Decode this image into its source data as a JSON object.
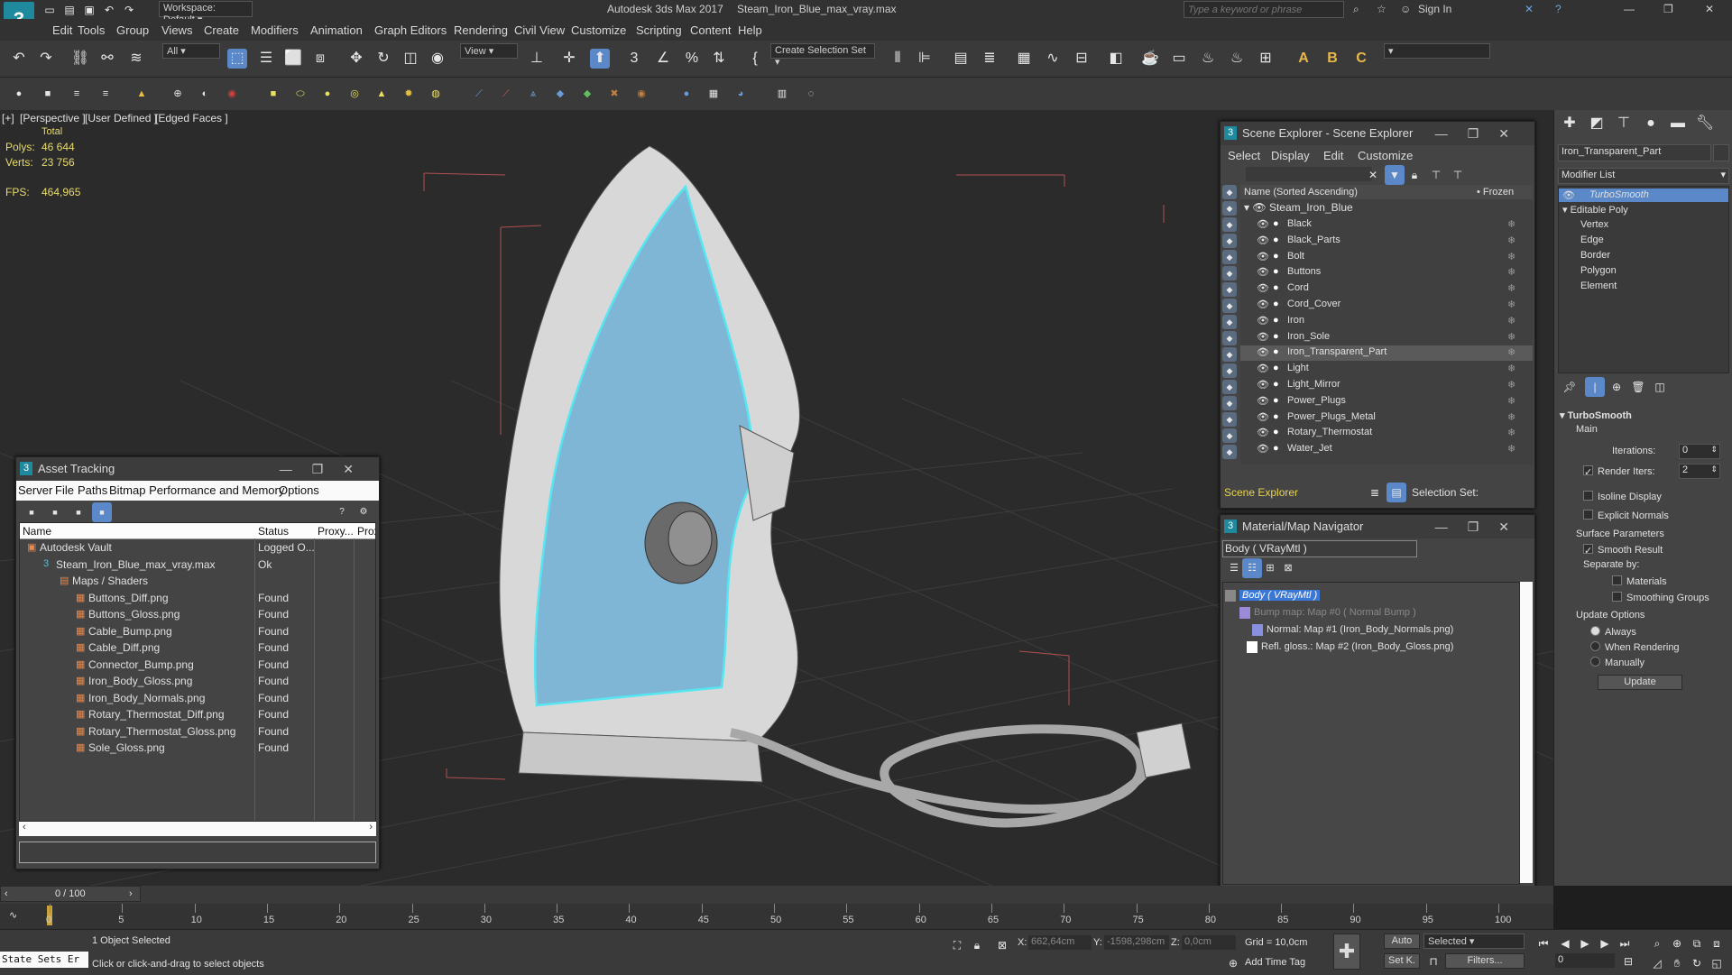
{
  "titlebar": {
    "workspace": "Workspace: Default",
    "app_title": "Autodesk 3ds Max 2017",
    "file_name": "Steam_Iron_Blue_max_vray.max",
    "search_placeholder": "Type a keyword or phrase",
    "sign_in": "Sign In"
  },
  "menu": [
    "Edit",
    "Tools",
    "Group",
    "Views",
    "Create",
    "Modifiers",
    "Animation",
    "Graph Editors",
    "Rendering",
    "Civil View",
    "Customize",
    "Scripting",
    "Content",
    "Help"
  ],
  "toolbar": {
    "filter_combo": "All",
    "view_combo": "View",
    "selection_set": "Create Selection Set"
  },
  "viewport": {
    "label_plus": "[+]",
    "label_view": "[Perspective ]",
    "label_shading": "[User Defined ]",
    "label_edged": "[Edged Faces ]",
    "stats_total": "Total",
    "polys_label": "Polys:",
    "polys_value": "46 644",
    "verts_label": "Verts:",
    "verts_value": "23 756",
    "fps_label": "FPS:",
    "fps_value": "464,965"
  },
  "asset_tracking": {
    "title": "Asset Tracking",
    "menu": [
      "Server",
      "File",
      "Paths",
      "Bitmap Performance and Memory",
      "Options"
    ],
    "columns": [
      "Name",
      "Status",
      "Proxy...",
      "Prox"
    ],
    "rows": [
      {
        "name": "Autodesk Vault",
        "status": "Logged O..."
      },
      {
        "name": "Steam_Iron_Blue_max_vray.max",
        "status": "Ok"
      },
      {
        "name": "Maps / Shaders",
        "status": ""
      },
      {
        "name": "Buttons_Diff.png",
        "status": "Found"
      },
      {
        "name": "Buttons_Gloss.png",
        "status": "Found"
      },
      {
        "name": "Cable_Bump.png",
        "status": "Found"
      },
      {
        "name": "Cable_Diff.png",
        "status": "Found"
      },
      {
        "name": "Connector_Bump.png",
        "status": "Found"
      },
      {
        "name": "Iron_Body_Gloss.png",
        "status": "Found"
      },
      {
        "name": "Iron_Body_Normals.png",
        "status": "Found"
      },
      {
        "name": "Rotary_Thermostat_Diff.png",
        "status": "Found"
      },
      {
        "name": "Rotary_Thermostat_Gloss.png",
        "status": "Found"
      },
      {
        "name": "Sole_Gloss.png",
        "status": "Found"
      }
    ]
  },
  "scene_explorer": {
    "title": "Scene Explorer - Scene Explorer",
    "menu": [
      "Select",
      "Display",
      "Edit",
      "Customize"
    ],
    "col_name": "Name (Sorted Ascending)",
    "col_frozen": "• Frozen",
    "root": "Steam_Iron_Blue",
    "items": [
      "Black",
      "Black_Parts",
      "Bolt",
      "Buttons",
      "Cord",
      "Cord_Cover",
      "Iron",
      "Iron_Sole",
      "Iron_Transparent_Part",
      "Light",
      "Light_Mirror",
      "Power_Plugs",
      "Power_Plugs_Metal",
      "Rotary_Thermostat",
      "Water_Jet"
    ],
    "footer_label": "Scene Explorer",
    "selection_set": "Selection Set:"
  },
  "material_nav": {
    "title": "Material/Map Navigator",
    "field": "Body  ( VRayMtl )",
    "items": [
      "Body  ( VRayMtl )",
      "Bump map: Map #0  ( Normal Bump )",
      "Normal: Map #1 (Iron_Body_Normals.png)",
      "Refl. gloss.: Map #2 (Iron_Body_Gloss.png)"
    ]
  },
  "command_panel": {
    "object_name": "Iron_Transparent_Part",
    "modifier_list": "Modifier List",
    "stack": [
      "TurboSmooth",
      "Editable Poly",
      "Vertex",
      "Edge",
      "Border",
      "Polygon",
      "Element"
    ],
    "rollout_title": "TurboSmooth",
    "main_label": "Main",
    "iterations_label": "Iterations:",
    "iterations_value": "0",
    "render_iters_label": "Render Iters:",
    "render_iters_value": "2",
    "isoline": "Isoline Display",
    "explicit_normals": "Explicit Normals",
    "surface_params": "Surface Parameters",
    "smooth_result": "Smooth Result",
    "separate_by": "Separate by:",
    "materials": "Materials",
    "smoothing_groups": "Smoothing Groups",
    "update_options": "Update Options",
    "always": "Always",
    "when_rendering": "When Rendering",
    "manually": "Manually",
    "update_btn": "Update"
  },
  "timeline": {
    "frame": "0 / 100",
    "ticks": [
      "0",
      "5",
      "10",
      "15",
      "20",
      "25",
      "30",
      "35",
      "40",
      "45",
      "50",
      "55",
      "60",
      "65",
      "70",
      "75",
      "80",
      "85",
      "90",
      "95",
      "100"
    ]
  },
  "status": {
    "state_sets": "State Sets Er",
    "selected": "1 Object Selected",
    "hint": "Click or click-and-drag to select objects",
    "x_label": "X:",
    "x_value": "662,64cm",
    "y_label": "Y:",
    "y_value": "-1598,298cm",
    "z_label": "Z:",
    "z_value": "0,0cm",
    "grid": "Grid = 10,0cm",
    "add_time_tag": "Add Time Tag",
    "auto": "Auto",
    "set_k": "Set K.",
    "selected_combo": "Selected",
    "filters": "Filters...",
    "frame_value": "0"
  }
}
